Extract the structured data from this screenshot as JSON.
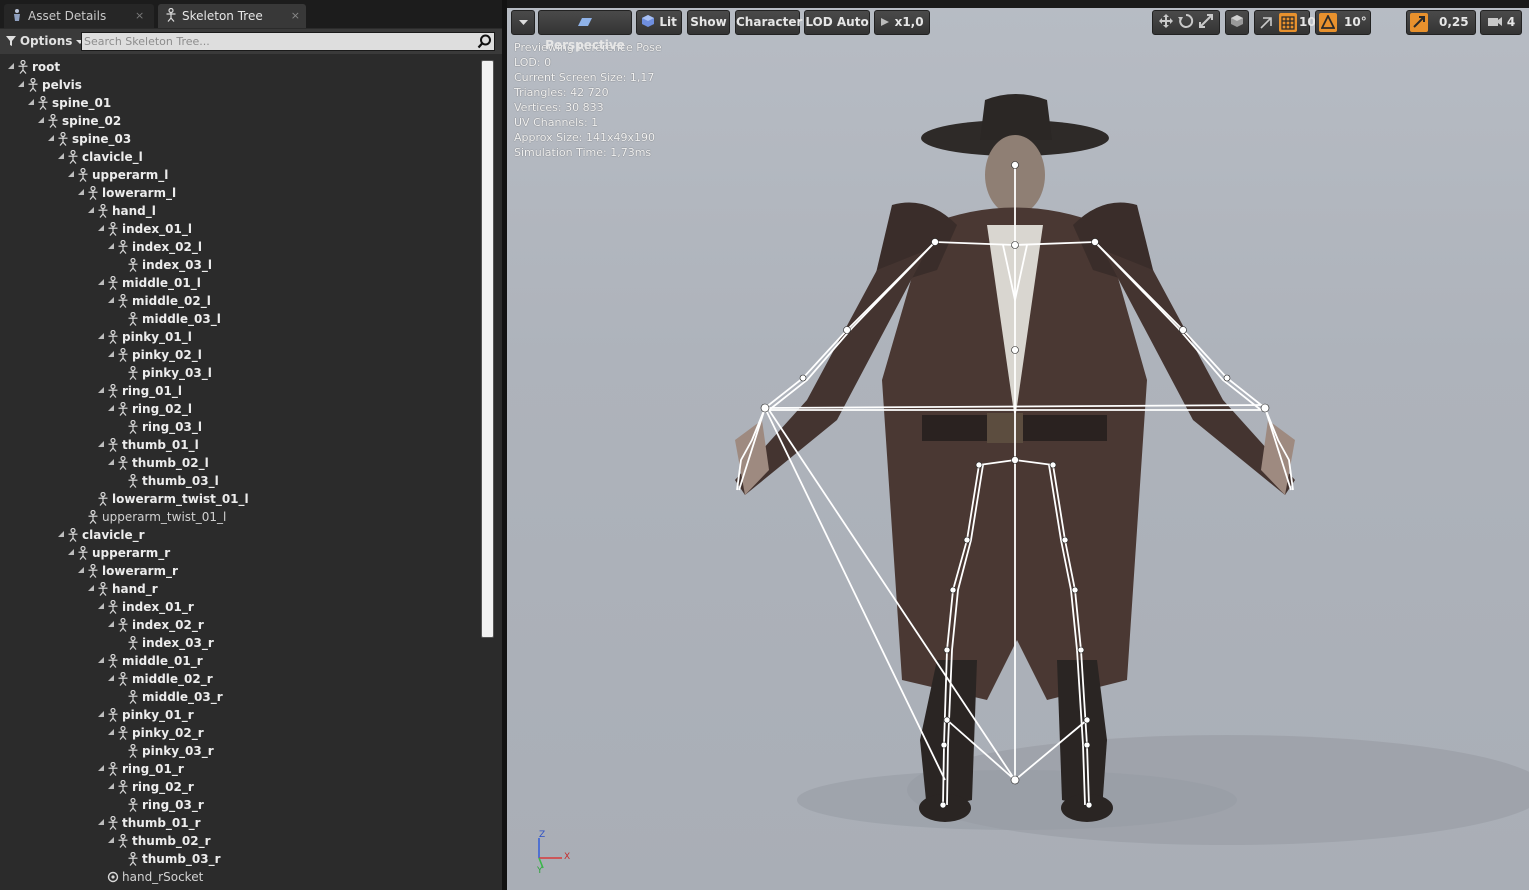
{
  "tabs": [
    {
      "label": "Asset Details",
      "icon": "bone-doc-icon"
    },
    {
      "label": "Skeleton Tree",
      "icon": "skeleton-icon"
    }
  ],
  "toolbar": {
    "options_label": "Options",
    "search_placeholder": "Search Skeleton Tree..."
  },
  "tree": [
    {
      "label": "root",
      "depth": 0
    },
    {
      "label": "pelvis",
      "depth": 1
    },
    {
      "label": "spine_01",
      "depth": 2
    },
    {
      "label": "spine_02",
      "depth": 3
    },
    {
      "label": "spine_03",
      "depth": 4
    },
    {
      "label": "clavicle_l",
      "depth": 5
    },
    {
      "label": "upperarm_l",
      "depth": 6
    },
    {
      "label": "lowerarm_l",
      "depth": 7
    },
    {
      "label": "hand_l",
      "depth": 8
    },
    {
      "label": "index_01_l",
      "depth": 9
    },
    {
      "label": "index_02_l",
      "depth": 10
    },
    {
      "label": "index_03_l",
      "depth": 11
    },
    {
      "label": "middle_01_l",
      "depth": 9
    },
    {
      "label": "middle_02_l",
      "depth": 10
    },
    {
      "label": "middle_03_l",
      "depth": 11
    },
    {
      "label": "pinky_01_l",
      "depth": 9
    },
    {
      "label": "pinky_02_l",
      "depth": 10
    },
    {
      "label": "pinky_03_l",
      "depth": 11
    },
    {
      "label": "ring_01_l",
      "depth": 9
    },
    {
      "label": "ring_02_l",
      "depth": 10
    },
    {
      "label": "ring_03_l",
      "depth": 11
    },
    {
      "label": "thumb_01_l",
      "depth": 9
    },
    {
      "label": "thumb_02_l",
      "depth": 10
    },
    {
      "label": "thumb_03_l",
      "depth": 11
    },
    {
      "label": "lowerarm_twist_01_l",
      "depth": 8
    },
    {
      "label": "upperarm_twist_01_l",
      "depth": 7,
      "light": true
    },
    {
      "label": "clavicle_r",
      "depth": 5
    },
    {
      "label": "upperarm_r",
      "depth": 6
    },
    {
      "label": "lowerarm_r",
      "depth": 7
    },
    {
      "label": "hand_r",
      "depth": 8
    },
    {
      "label": "index_01_r",
      "depth": 9
    },
    {
      "label": "index_02_r",
      "depth": 10
    },
    {
      "label": "index_03_r",
      "depth": 11
    },
    {
      "label": "middle_01_r",
      "depth": 9
    },
    {
      "label": "middle_02_r",
      "depth": 10
    },
    {
      "label": "middle_03_r",
      "depth": 11
    },
    {
      "label": "pinky_01_r",
      "depth": 9
    },
    {
      "label": "pinky_02_r",
      "depth": 10
    },
    {
      "label": "pinky_03_r",
      "depth": 11
    },
    {
      "label": "ring_01_r",
      "depth": 9
    },
    {
      "label": "ring_02_r",
      "depth": 10
    },
    {
      "label": "ring_03_r",
      "depth": 11
    },
    {
      "label": "thumb_01_r",
      "depth": 9
    },
    {
      "label": "thumb_02_r",
      "depth": 10
    },
    {
      "label": "thumb_03_r",
      "depth": 11
    },
    {
      "label": "hand_rSocket",
      "depth": 9,
      "light": true,
      "socket": true
    }
  ],
  "viewport": {
    "buttons": {
      "perspective": "Perspective",
      "lit": "Lit",
      "show": "Show",
      "character": "Character",
      "lod": "LOD Auto",
      "speed": "x1,0",
      "grid_snap": "10",
      "rot_snap": "10°",
      "scale_snap": "0,25",
      "cam_speed": "4"
    },
    "stats": [
      "Previewing Reference Pose",
      "LOD: 0",
      "Current Screen Size: 1,17",
      "Triangles: 42 720",
      "Vertices: 30 833",
      "UV Channels: 1",
      "Approx Size: 141x49x190",
      "Simulation Time: 1,73ms"
    ],
    "axis": {
      "x": "X",
      "y": "Y",
      "z": "Z"
    }
  },
  "colors": {
    "accent_orange": "#e8912d",
    "panel_bg": "#2b2b2b",
    "viewport_bg": "#afb4bc"
  }
}
